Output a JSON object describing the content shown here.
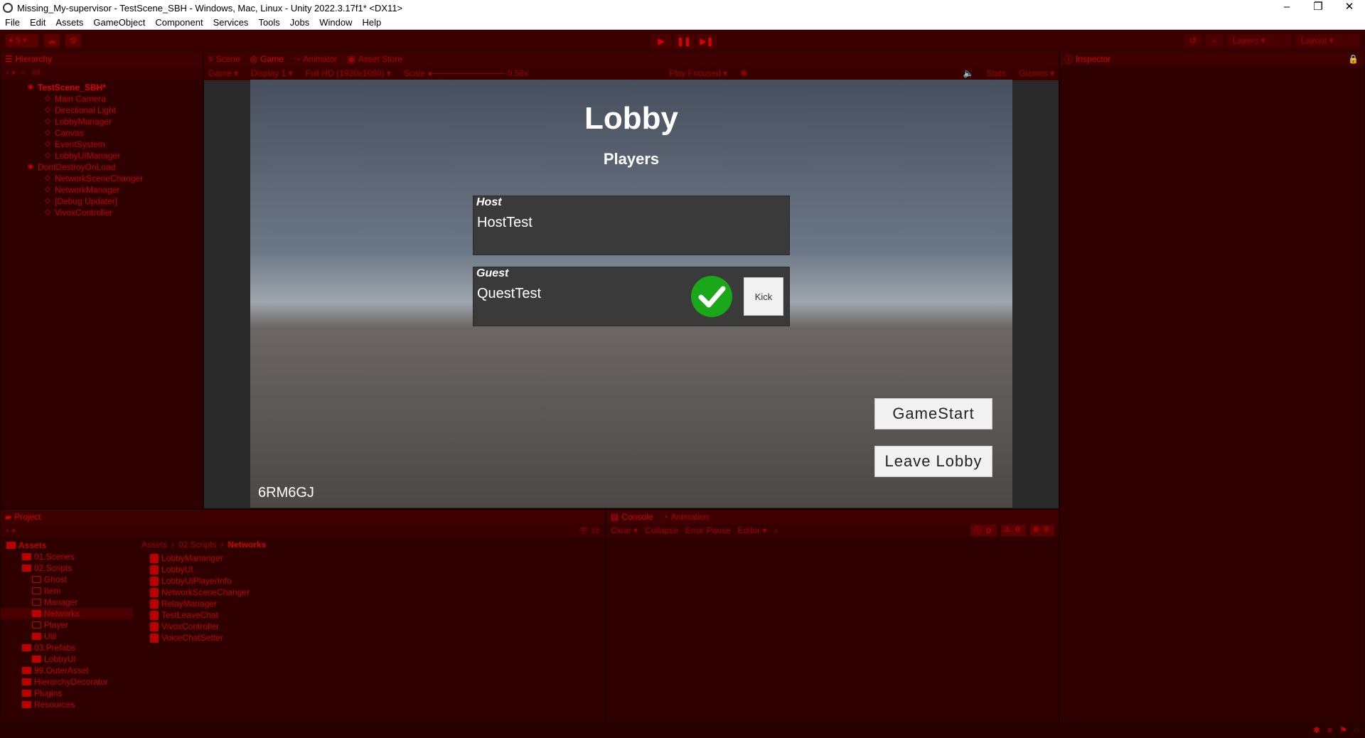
{
  "window": {
    "title": "Missing_My-supervisor - TestScene_SBH - Windows, Mac, Linux - Unity 2022.3.17f1* <DX11>"
  },
  "menu": [
    "File",
    "Edit",
    "Assets",
    "GameObject",
    "Component",
    "Services",
    "Tools",
    "Jobs",
    "Window",
    "Help"
  ],
  "toolbar": {
    "account": "S",
    "layers": "Layers",
    "layout": "Layout"
  },
  "hierarchy": {
    "tab": "Hierarchy",
    "search": "All",
    "items": [
      {
        "label": "TestScene_SBH*",
        "type": "scene"
      },
      {
        "label": "Main Camera",
        "type": "child"
      },
      {
        "label": "Directional Light",
        "type": "child"
      },
      {
        "label": "LobbyManager",
        "type": "child"
      },
      {
        "label": "Canvas",
        "type": "child"
      },
      {
        "label": "EventSystem",
        "type": "child"
      },
      {
        "label": "LobbyUIManager",
        "type": "child"
      },
      {
        "label": "DontDestroyOnLoad",
        "type": "scene"
      },
      {
        "label": "NetworkSceneChanger",
        "type": "child"
      },
      {
        "label": "NetworkManager",
        "type": "child"
      },
      {
        "label": "[Debug Updater]",
        "type": "child"
      },
      {
        "label": "VivoxController",
        "type": "child"
      }
    ]
  },
  "center_tabs": [
    "Scene",
    "Game",
    "Animator",
    "Asset Store"
  ],
  "game_toolbar": {
    "mode": "Game",
    "display": "Display 1",
    "resolution": "Full HD (1920x1080)",
    "scale_label": "Scale",
    "scale_value": "0.56x",
    "play_focused": "Play Focused",
    "stats": "Stats",
    "gizmos": "Gizmos"
  },
  "game": {
    "title": "Lobby",
    "subtitle": "Players",
    "host_role": "Host",
    "host_name": "HostTest",
    "guest_role": "Guest",
    "guest_name": "QuestTest",
    "kick_label": "Kick",
    "start_label": "GameStart",
    "leave_label": "Leave Lobby",
    "lobby_code": "6RM6GJ"
  },
  "inspector": {
    "tab": "Inspector"
  },
  "project": {
    "tab": "Project",
    "count": "38",
    "folders": [
      {
        "label": "Assets",
        "level": 0,
        "bold": true
      },
      {
        "label": "01.Scenes",
        "level": 1
      },
      {
        "label": "02.Scripts",
        "level": 1
      },
      {
        "label": "Ghost",
        "level": 2
      },
      {
        "label": "Item",
        "level": 2
      },
      {
        "label": "Manager",
        "level": 2
      },
      {
        "label": "Networks",
        "level": 2
      },
      {
        "label": "Player",
        "level": 2
      },
      {
        "label": "Util",
        "level": 2
      },
      {
        "label": "03.Prefabs",
        "level": 1
      },
      {
        "label": "LobbyUI",
        "level": 2
      },
      {
        "label": "99.OuterAsset",
        "level": 1
      },
      {
        "label": "HierarchyDecorator",
        "level": 1
      },
      {
        "label": "Plugins",
        "level": 1
      },
      {
        "label": "Resources",
        "level": 1
      }
    ],
    "breadcrumb": [
      "Assets",
      "02.Scripts",
      "Networks"
    ],
    "files": [
      "LobbyMananger",
      "LobbyUI",
      "LobbyUIPlayerInfo",
      "NetworkSceneChanger",
      "RelayManager",
      "TestLeaveChat",
      "VivoxController",
      "VoiceChatSetter"
    ]
  },
  "console": {
    "tabs": [
      "Console",
      "Animation"
    ],
    "clear": "Clear",
    "collapse": "Collapse",
    "error_pause": "Error Pause",
    "editor": "Editor",
    "log_count": "0",
    "warn_count": "0",
    "error_count": "0"
  }
}
